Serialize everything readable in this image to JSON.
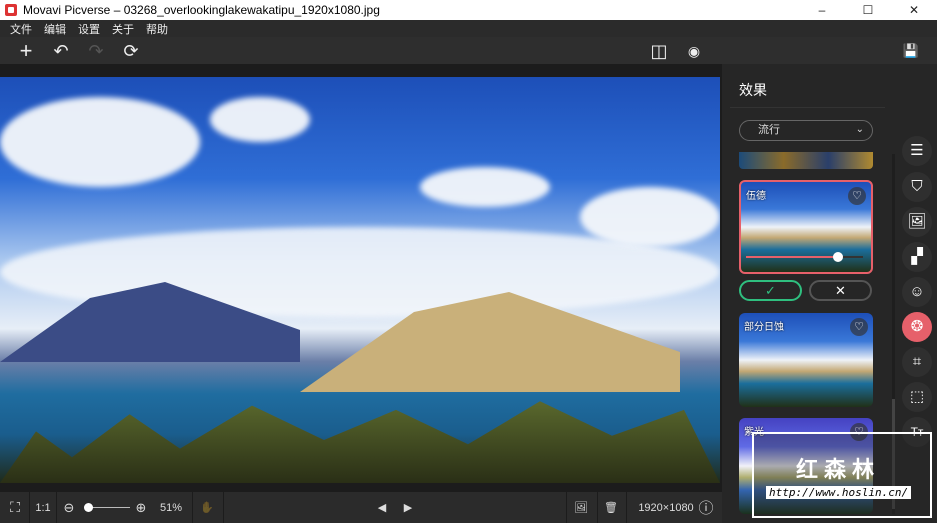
{
  "window": {
    "title": "Movavi Picverse – 03268_overlookinglakewakatipu_1920x1080.jpg",
    "minimize": "–",
    "maximize": "☐",
    "close": "✕"
  },
  "menu": [
    "文件",
    "编辑",
    "设置",
    "关于",
    "帮助"
  ],
  "toolbar": {
    "add": "+",
    "undo": "↶",
    "redo": "↷",
    "reset": "⟳",
    "compare": "◫",
    "preview": "◉",
    "save": "💾"
  },
  "bottom": {
    "fit": "⛶",
    "one_to_one": "1:1",
    "zoom_out": "⊖",
    "zoom_in": "⊕",
    "zoom_level": "51%",
    "zoom_fraction": 0.05,
    "hand": "✋",
    "prev": "◀",
    "next": "▶",
    "export": "🖼",
    "delete": "🗑",
    "dimensions": "1920×1080",
    "info": "ⓘ"
  },
  "panel": {
    "title": "效果",
    "category": "流行",
    "chevron": "⌄",
    "cards": [
      {
        "label": "伍德",
        "intensity": 0.78
      },
      {
        "label": "部分日蚀"
      },
      {
        "label": "紫光"
      }
    ],
    "apply": "✓",
    "cancel": "✕",
    "heart": "♡"
  },
  "sidebar_icons": [
    "☰",
    "⛉",
    "🖼",
    "▞",
    "☺",
    "❂",
    "⌗",
    "⬚",
    "Tт"
  ],
  "watermark": {
    "text": "红森林",
    "url": "http://www.hoslin.cn/"
  }
}
